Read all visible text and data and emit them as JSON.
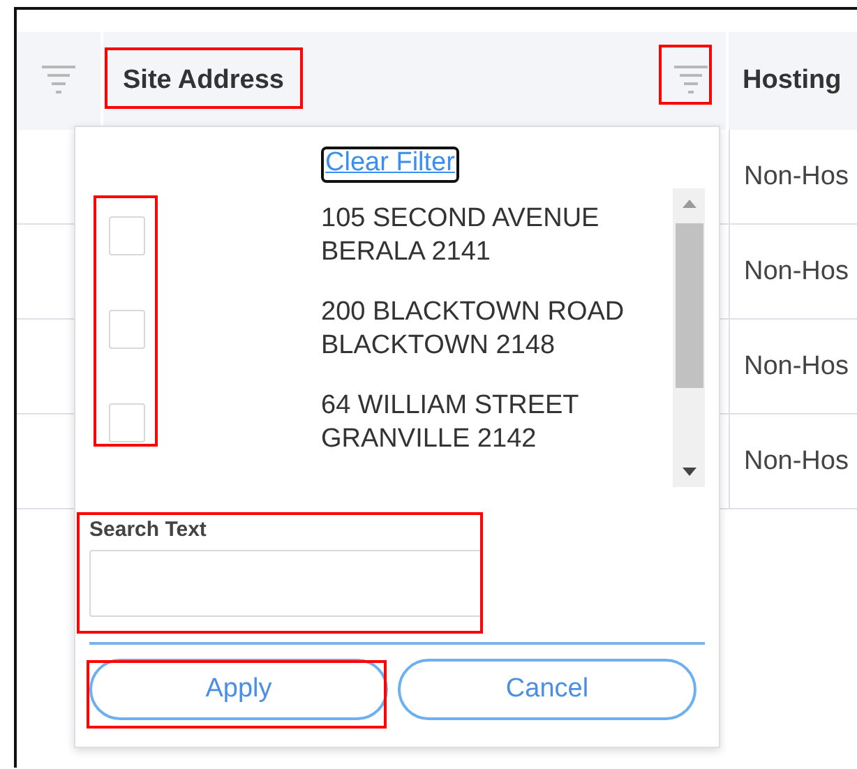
{
  "table": {
    "columns": [
      {
        "kind": "filter"
      },
      {
        "kind": "filter-label",
        "label": "Site Address"
      },
      {
        "kind": "label",
        "label": "Hosting"
      }
    ],
    "rows": [
      {
        "hosting": "Non-Hos"
      },
      {
        "hosting": "Non-Hos"
      },
      {
        "hosting": "Non-Hos"
      },
      {
        "hosting": "Non-Hos"
      }
    ]
  },
  "filter_popup": {
    "clear_filter": "Clear Filter",
    "options": [
      {
        "lines": [
          "105 SECOND AVENUE",
          "BERALA 2141"
        ],
        "checked": false
      },
      {
        "lines": [
          "200 BLACKTOWN ROAD",
          "BLACKTOWN 2148"
        ],
        "checked": false
      },
      {
        "lines": [
          "64 WILLIAM STREET",
          "GRANVILLE 2142"
        ],
        "checked": false
      }
    ],
    "search": {
      "label": "Search Text"
    },
    "buttons": [
      {
        "label": "Apply"
      },
      {
        "label": "Cancel"
      }
    ]
  }
}
